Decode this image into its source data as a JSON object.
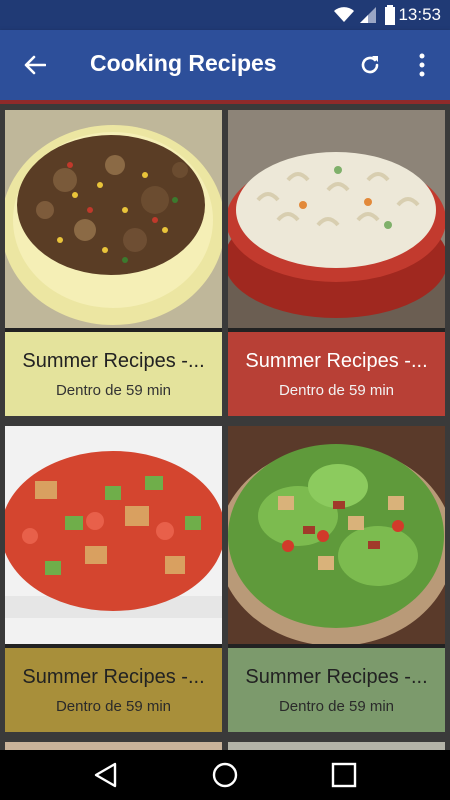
{
  "status_bar": {
    "time": "13:53"
  },
  "app_bar": {
    "title": "Cooking Recipes"
  },
  "recipes": [
    {
      "name": "Summer Recipes -...",
      "subtitle": "Dentro de 59 min",
      "caption_color": "#e4e39c",
      "text_color": "#222222",
      "sub_color": "#333333",
      "photo": "stir-fry"
    },
    {
      "name": "Summer Recipes -...",
      "subtitle": "Dentro de 59 min",
      "caption_color": "#b84036",
      "text_color": "#ffffff",
      "sub_color": "#f2f2f2",
      "photo": "pasta-salad"
    },
    {
      "name": "Summer Recipes -...",
      "subtitle": "Dentro de 59 min",
      "caption_color": "#a88f3a",
      "text_color": "#222222",
      "sub_color": "#2a2a2a",
      "photo": "bread-salad"
    },
    {
      "name": "Summer Recipes -...",
      "subtitle": "Dentro de 59 min",
      "caption_color": "#7c9a6c",
      "text_color": "#222222",
      "sub_color": "#2a2a2a",
      "photo": "green-salad"
    }
  ],
  "icons": {
    "back": "arrow-back-icon",
    "refresh": "refresh-icon",
    "more": "more-vert-icon",
    "nav_back": "triangle-back-icon",
    "nav_home": "circle-home-icon",
    "nav_recents": "square-recents-icon"
  }
}
